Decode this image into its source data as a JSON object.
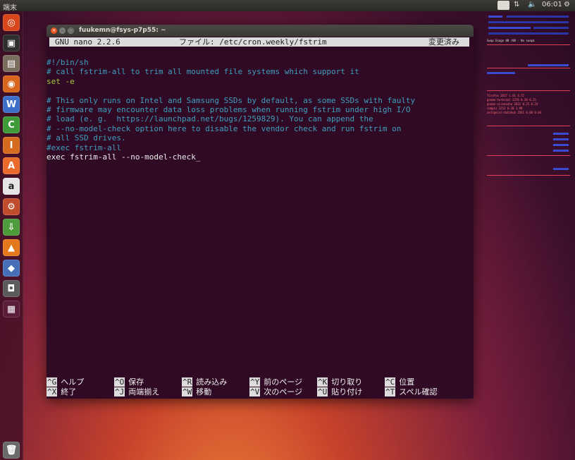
{
  "top_panel": {
    "app_name": "端末",
    "keyboard_indicator": "KB",
    "clock": "06:01"
  },
  "launcher": {
    "items": [
      {
        "name": "dash-home",
        "glyph": "◎",
        "color": "#d8461c"
      },
      {
        "name": "terminal",
        "glyph": "▣",
        "color": "#2f2f2f"
      },
      {
        "name": "files",
        "glyph": "▤",
        "color": "#7b6d5e"
      },
      {
        "name": "firefox",
        "glyph": "◉",
        "color": "#d9661d"
      },
      {
        "name": "writer",
        "glyph": "W",
        "color": "#3d6fc9"
      },
      {
        "name": "calc",
        "glyph": "C",
        "color": "#3f9a3a"
      },
      {
        "name": "impress",
        "glyph": "I",
        "color": "#d46b1f"
      },
      {
        "name": "software-center",
        "glyph": "A",
        "color": "#e96a2a"
      },
      {
        "name": "amazon",
        "glyph": "a",
        "color": "#e6e6e6"
      },
      {
        "name": "system-settings",
        "glyph": "⚙",
        "color": "#c04c2c"
      },
      {
        "name": "update-manager",
        "glyph": "⇩",
        "color": "#4e9b3c"
      },
      {
        "name": "vlc",
        "glyph": "▲",
        "color": "#e4781c"
      },
      {
        "name": "virtualbox",
        "glyph": "◆",
        "color": "#4570b8"
      },
      {
        "name": "screenshot",
        "glyph": "◘",
        "color": "#5b5b5b"
      },
      {
        "name": "workspace-switcher",
        "glyph": "▦",
        "color": "#5a1d3a"
      },
      {
        "name": "trash",
        "glyph": "🗑",
        "color": "#6a6a6a"
      }
    ]
  },
  "terminal": {
    "title": "fuukemn@fsys-p7p55: ~",
    "nano_header": {
      "version": "GNU nano 2.2.6",
      "file": "ファイル: /etc/cron.weekly/fstrim",
      "status": "変更済み"
    },
    "lines": [
      {
        "text": "#!/bin/sh",
        "style": "c-com"
      },
      {
        "text": "# call fstrim-all to trim all mounted file systems which support it",
        "style": "c-com"
      },
      {
        "text": "set -e",
        "style": "c-kw"
      },
      {
        "text": "",
        "style": "c-txt"
      },
      {
        "text": "# This only runs on Intel and Samsung SSDs by default, as some SSDs with faulty",
        "style": "c-com"
      },
      {
        "text": "# firmware may encounter data loss problems when running fstrim under high I/O",
        "style": "c-com"
      },
      {
        "text": "# load (e. g.  https://launchpad.net/bugs/1259829). You can append the",
        "style": "c-com"
      },
      {
        "text": "# --no-model-check option here to disable the vendor check and run fstrim on",
        "style": "c-com"
      },
      {
        "text": "# all SSD drives.",
        "style": "c-com"
      },
      {
        "text": "#exec fstrim-all",
        "style": "c-com"
      },
      {
        "text": "exec fstrim-all --no-model-check",
        "style": "c-txt"
      }
    ],
    "shortcuts": [
      {
        "key": "^G",
        "label": "ヘルプ"
      },
      {
        "key": "^X",
        "label": "終了"
      },
      {
        "key": "^O",
        "label": "保存"
      },
      {
        "key": "^J",
        "label": "両端揃え"
      },
      {
        "key": "^R",
        "label": "読み込み"
      },
      {
        "key": "^W",
        "label": "移動"
      },
      {
        "key": "^Y",
        "label": "前のページ"
      },
      {
        "key": "^V",
        "label": "次のページ"
      },
      {
        "key": "^K",
        "label": "切り取り"
      },
      {
        "key": "^U",
        "label": "貼り付け"
      },
      {
        "key": "^C",
        "label": "位置"
      },
      {
        "key": "^T",
        "label": "スペル確認"
      }
    ]
  },
  "conky": {
    "swap_usage": "Swap Usage  0B  /0B   - No swap$",
    "process_rows": [
      {
        "name": "firefox",
        "pid": "2617",
        "cpu": "1.01",
        "mem": "4.72"
      },
      {
        "name": "gnome-terminal",
        "pid": "2376",
        "cpu": "0.30",
        "mem": "0.25"
      },
      {
        "name": "gnome-screensho",
        "pid": "2822",
        "cpu": "0.25",
        "mem": "0.24"
      },
      {
        "name": "compiz",
        "pid": "2212",
        "cpu": "0.20",
        "mem": "1.98"
      },
      {
        "name": "zeitgeist-datahub",
        "pid": "2561",
        "cpu": "0.00",
        "mem": "0.04"
      }
    ]
  }
}
